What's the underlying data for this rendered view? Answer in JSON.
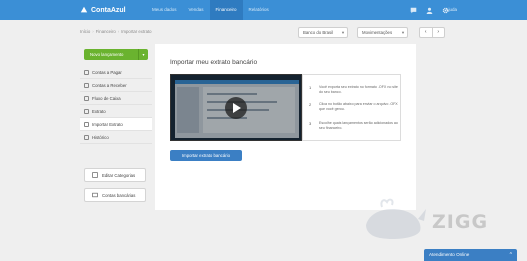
{
  "brand": {
    "name": "ContaAzul"
  },
  "nav": {
    "items": [
      {
        "label": "Meus dados"
      },
      {
        "label": "Vendas"
      },
      {
        "label": "Financeiro"
      },
      {
        "label": "Relatórios"
      }
    ]
  },
  "topbar": {
    "help_label": "Ajuda"
  },
  "breadcrumb": {
    "items": [
      "Início",
      "Financeiro",
      "Importar extrato"
    ],
    "separator": "›"
  },
  "filters": {
    "bank_value": "Banco do Brasil",
    "account_value": "Movimentações",
    "prev_icon": "‹",
    "next_icon": "›"
  },
  "sidebar": {
    "new_button_label": "Novo lançamento",
    "items": [
      {
        "label": "Contas a Pagar"
      },
      {
        "label": "Contas a Receber"
      },
      {
        "label": "Fluxo de Caixa"
      },
      {
        "label": "Extrato"
      },
      {
        "label": "Importar Extrato"
      },
      {
        "label": "Histórico"
      }
    ],
    "edit_categories_label": "Editar Categorias",
    "bank_accounts_label": "Contas bancárias"
  },
  "main": {
    "title": "Importar meu extrato bancário",
    "steps": [
      {
        "number": "1",
        "text": "Você exporta seu extrato no formato .OFX no site do seu banco."
      },
      {
        "number": "2",
        "text": "Clica no botão abaixo para enviar o arquivo .OFX que você gerou."
      },
      {
        "number": "3",
        "text": "Escolhe quais lançamentos serão adicionados ao seu financeiro."
      }
    ],
    "import_button_label": "Importar extrato bancário"
  },
  "watermark": {
    "text": "ZIGG"
  },
  "chat": {
    "label": "Atendimento Online",
    "chevron": "^"
  },
  "colors": {
    "topbar": "#3b8fd6",
    "primary_button": "#3b7fc4",
    "new_button": "#6ab32f",
    "page_background": "#efefef"
  }
}
